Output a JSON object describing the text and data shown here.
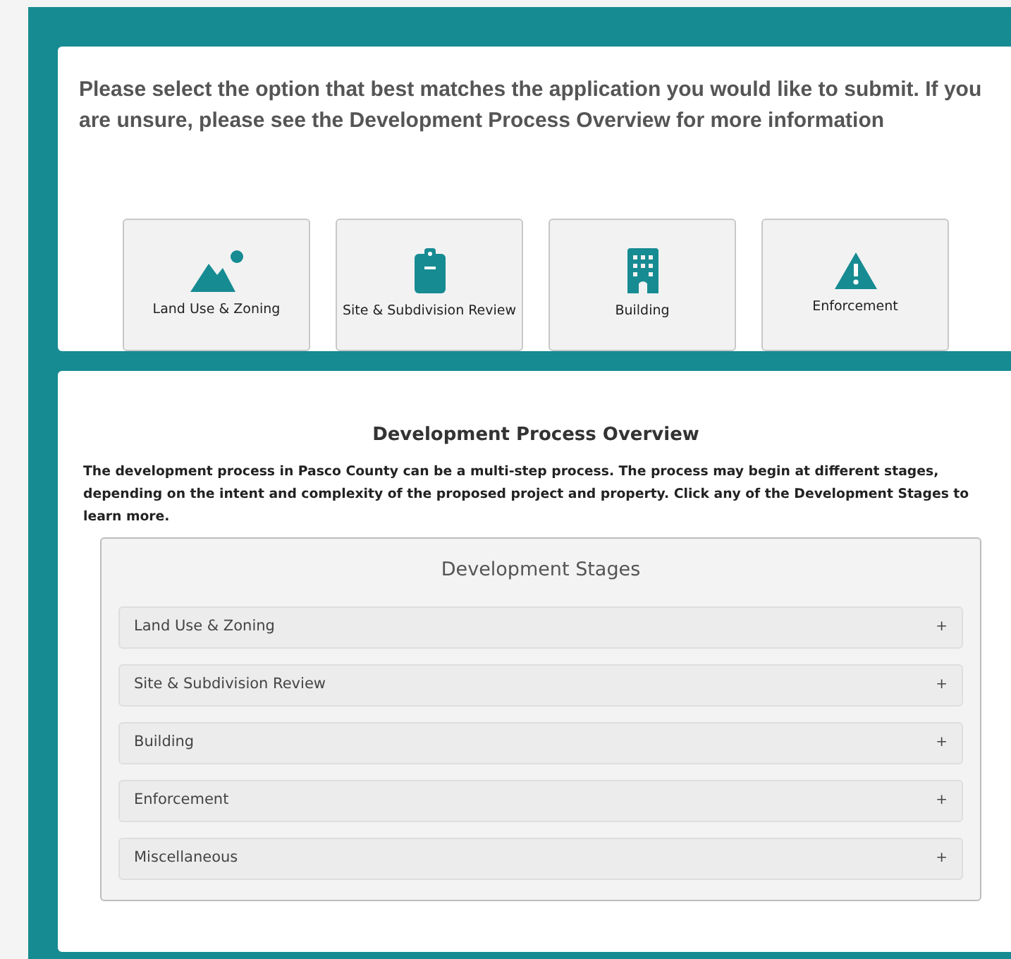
{
  "intro": "Please select the option that best matches the application you would like to submit. If you are unsure, please see the Development Process Overview for more information",
  "options": [
    {
      "label": "Land Use & Zoning",
      "kind": "landscape"
    },
    {
      "label": "Site & Subdivision Review",
      "kind": "clipboard"
    },
    {
      "label": "Building",
      "kind": "building"
    },
    {
      "label": "Enforcement",
      "kind": "warning"
    }
  ],
  "overview": {
    "title": "Development Process Overview",
    "description": "The development process in Pasco County can be a multi-step process. The process may begin at different stages, depending on the intent and complexity of the proposed project and property. Click any of the Development Stages to learn more.",
    "panel_title": "Development Stages",
    "stages": [
      {
        "label": "Land Use & Zoning",
        "toggle": "+",
        "expanded": false
      },
      {
        "label": "Site & Subdivision Review",
        "toggle": "+",
        "expanded": false
      },
      {
        "label": "Building",
        "toggle": "+",
        "expanded": false
      },
      {
        "label": "Enforcement",
        "toggle": "+",
        "expanded": false
      },
      {
        "label": "Miscellaneous",
        "toggle": "+",
        "expanded": false
      }
    ]
  }
}
